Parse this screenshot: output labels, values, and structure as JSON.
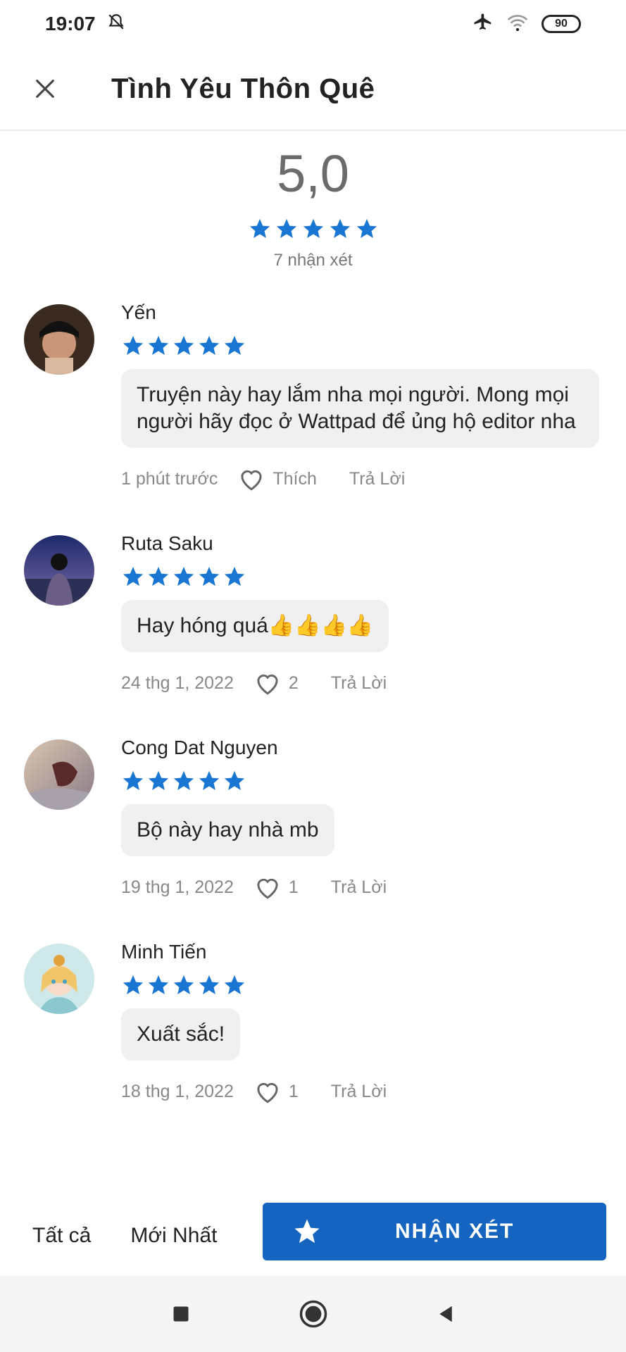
{
  "status_bar": {
    "time": "19:07",
    "battery": "90",
    "icons": [
      "bell-off-icon",
      "airplane-icon",
      "wifi-icon",
      "battery-icon"
    ]
  },
  "app_bar": {
    "title": "Tình Yêu Thôn Quê",
    "close_icon": "close-icon"
  },
  "summary": {
    "score": "5,0",
    "stars": 5,
    "count_text": "7 nhận xét"
  },
  "reviews": [
    {
      "name": "Yến",
      "stars": 5,
      "text": "Truyện này hay lắm nha mọi người. Mong mọi người hãy đọc ở Wattpad để ủng hộ editor nha",
      "date": "1 phút trước",
      "like_label": "Thích",
      "reply_label": "Trả Lời"
    },
    {
      "name": "Ruta Saku",
      "stars": 5,
      "text": "Hay hóng quá👍👍👍👍",
      "date": "24 thg 1, 2022",
      "like_label": "2",
      "reply_label": "Trả Lời"
    },
    {
      "name": "Cong Dat Nguyen",
      "stars": 5,
      "text": "Bộ này hay nhà mb",
      "date": "19 thg 1, 2022",
      "like_label": "1",
      "reply_label": "Trả Lời"
    },
    {
      "name": "Minh Tiến",
      "stars": 5,
      "text": "Xuất sắc!",
      "date": "18 thg 1, 2022",
      "like_label": "1",
      "reply_label": "Trả Lời"
    }
  ],
  "bottom_bar": {
    "filter_all": "Tất cả",
    "filter_newest": "Mới Nhất",
    "review_button": "NHẬN XÉT"
  },
  "colors": {
    "accent": "#1565c0",
    "star": "#1976d2",
    "bubble": "#f0f0f0"
  }
}
